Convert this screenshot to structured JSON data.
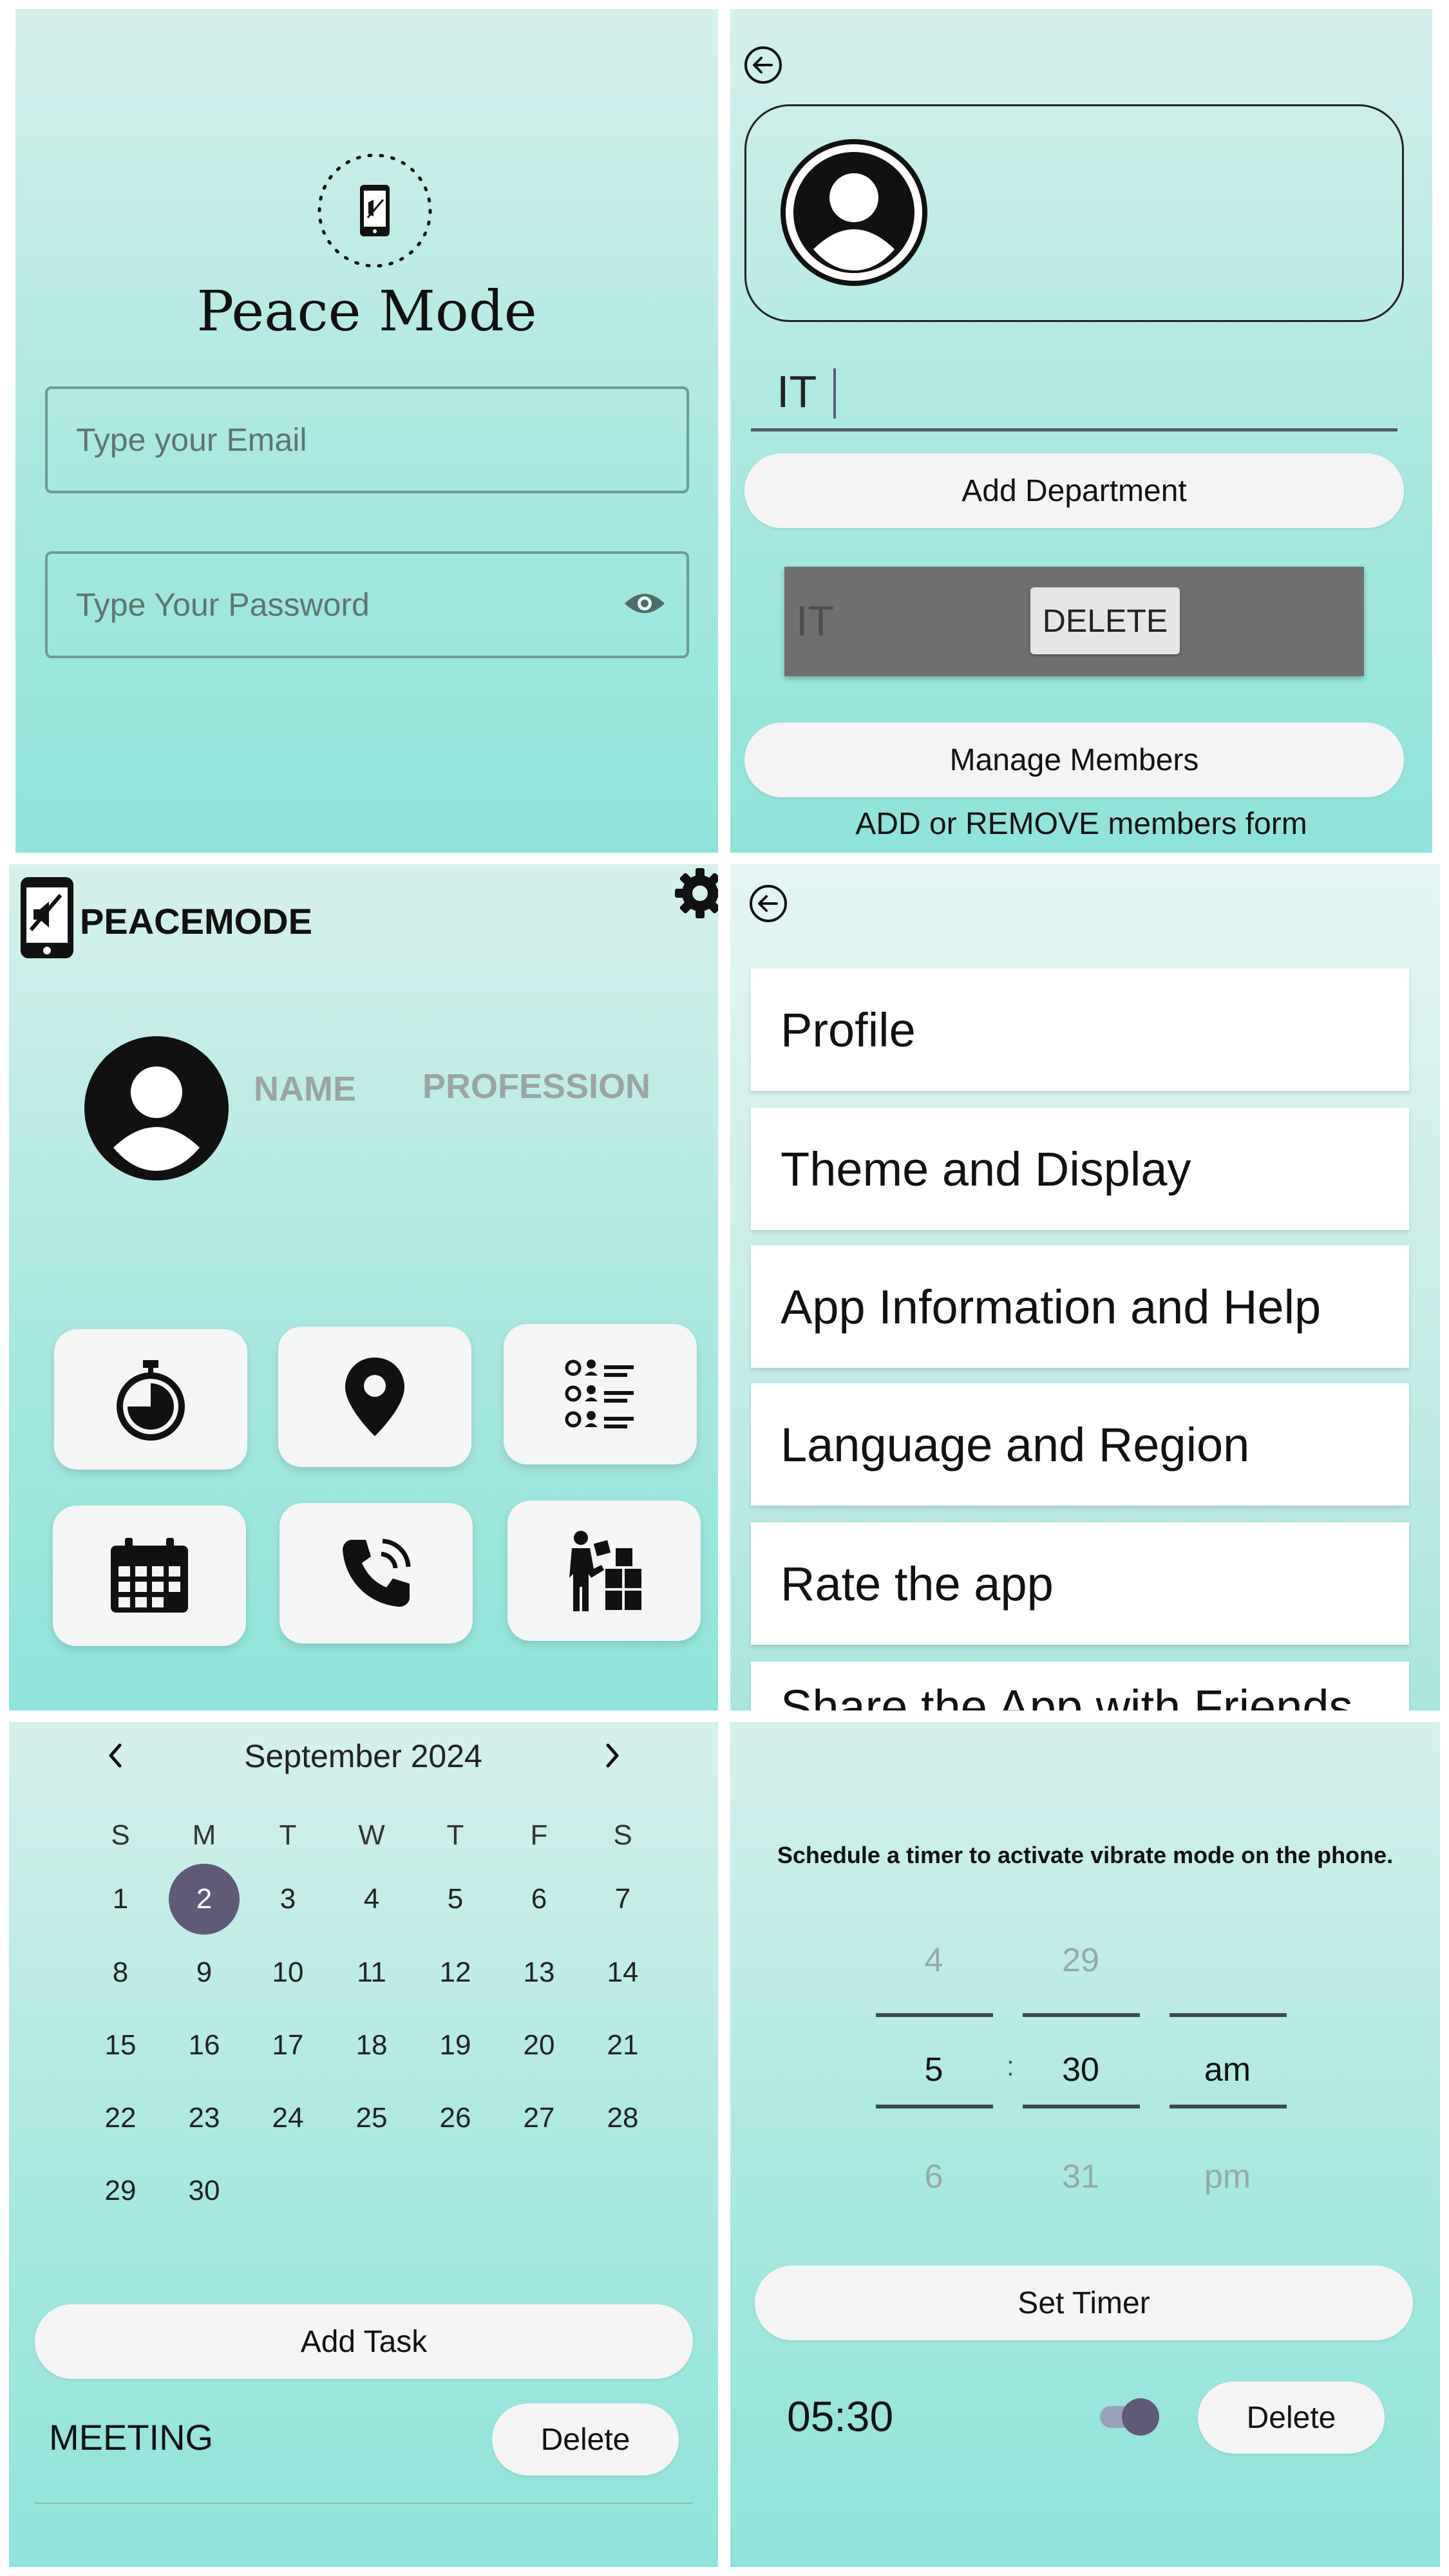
{
  "login": {
    "logo_ring_text": "Peace Mode",
    "app_title": "Peace Mode",
    "email_placeholder": "Type your Email",
    "password_placeholder": "Type Your Password",
    "eye_icon": "eye-icon"
  },
  "department": {
    "back_icon": "back-arrow-icon",
    "input_value": "IT",
    "add_button": "Add Department",
    "list_item_name": "IT",
    "delete_button": "DELETE",
    "manage_button": "Manage Members",
    "footer_text": "ADD or REMOVE members form"
  },
  "dashboard": {
    "brand": "PEACEMODE",
    "name_label": "NAME",
    "profession_label": "PROFESSION",
    "tiles": [
      "timer-icon",
      "location-pin-icon",
      "task-list-icon",
      "calendar-icon",
      "phone-call-icon",
      "worker-boxes-icon"
    ]
  },
  "settings": {
    "items": [
      "Profile",
      "Theme and Display",
      "App Information and Help",
      "Language and Region",
      "Rate the app",
      "Share the App with Friends"
    ]
  },
  "calendar": {
    "month": "September 2024",
    "weekdays": [
      "S",
      "M",
      "T",
      "W",
      "T",
      "F",
      "S"
    ],
    "days": [
      "1",
      "2",
      "3",
      "4",
      "5",
      "6",
      "7",
      "8",
      "9",
      "10",
      "11",
      "12",
      "13",
      "14",
      "15",
      "16",
      "17",
      "18",
      "19",
      "20",
      "21",
      "22",
      "23",
      "24",
      "25",
      "26",
      "27",
      "28",
      "29",
      "30"
    ],
    "selected_day": "2",
    "add_task_button": "Add Task",
    "task_name": "MEETING",
    "task_delete_button": "Delete"
  },
  "timer": {
    "description": "Schedule a timer to activate vibrate mode on the phone.",
    "hour_prev": "4",
    "hour": "5",
    "hour_next": "6",
    "separator": ":",
    "minute_prev": "29",
    "minute": "30",
    "minute_next": "31",
    "ampm": "am",
    "ampm_next": "pm",
    "set_button": "Set Timer",
    "saved_time": "05:30",
    "delete_button": "Delete",
    "accent": "#5f5a78"
  }
}
